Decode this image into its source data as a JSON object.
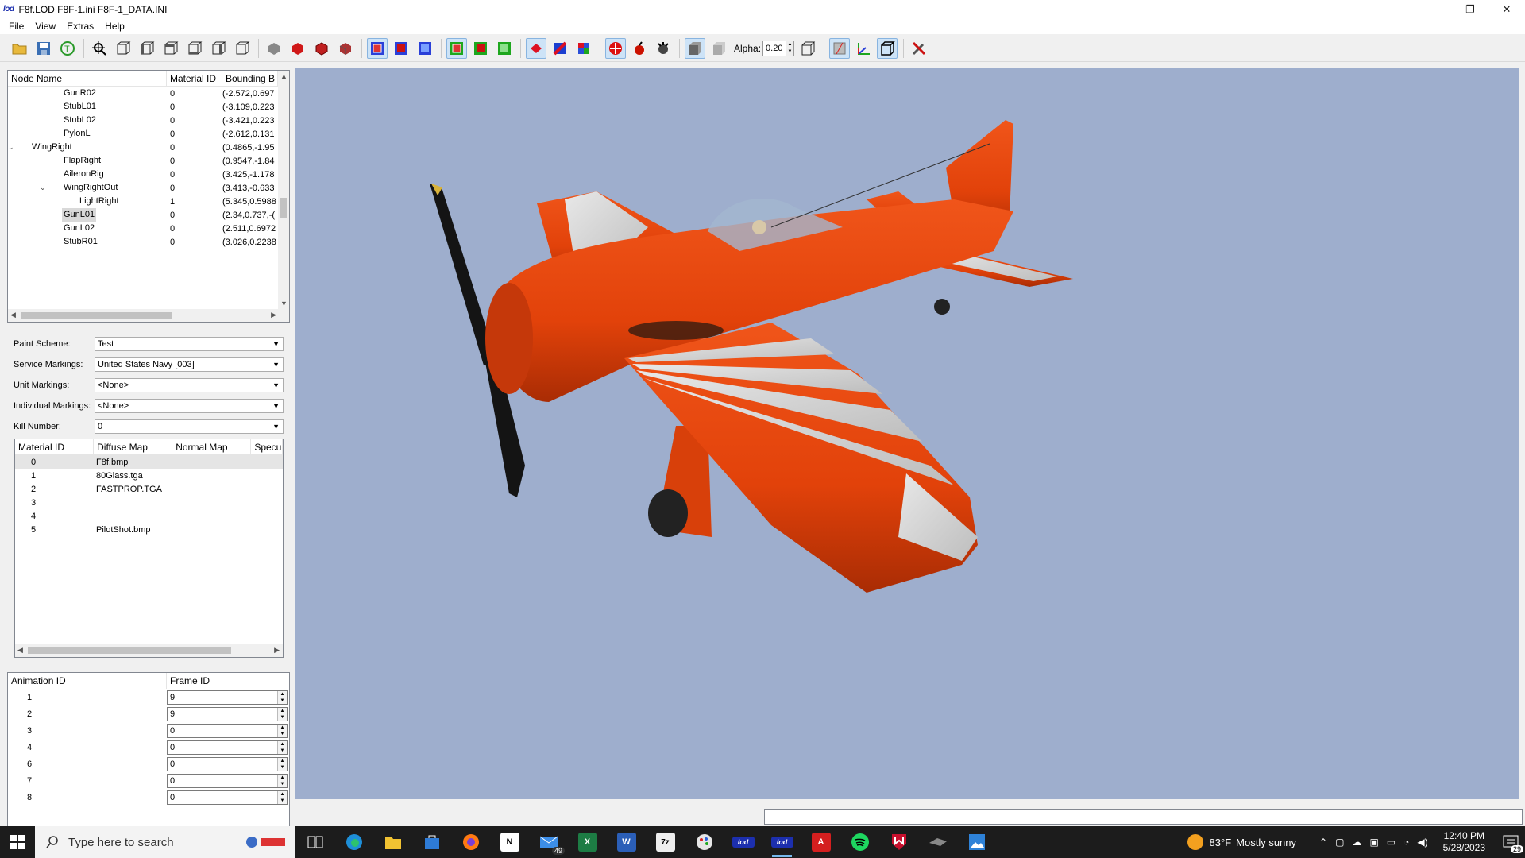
{
  "window": {
    "logo": "lod",
    "title": "F8f.LOD  F8F-1.ini  F8F-1_DATA.INI",
    "controls": {
      "minimize": "—",
      "restore": "❐",
      "close": "✕"
    }
  },
  "menu": [
    "File",
    "View",
    "Extras",
    "Help"
  ],
  "toolbar": {
    "alpha_label": "Alpha:",
    "alpha_value": "0.20"
  },
  "node_tree": {
    "headers": [
      "Node Name",
      "Material ID",
      "Bounding B"
    ],
    "rows": [
      {
        "name": "GunR02",
        "material": "0",
        "bounds": "(-2.572,0.697",
        "indent": 2,
        "caret": ""
      },
      {
        "name": "StubL01",
        "material": "0",
        "bounds": "(-3.109,0.223",
        "indent": 2,
        "caret": ""
      },
      {
        "name": "StubL02",
        "material": "0",
        "bounds": "(-3.421,0.223",
        "indent": 2,
        "caret": ""
      },
      {
        "name": "PylonL",
        "material": "0",
        "bounds": "(-2.612,0.131",
        "indent": 2,
        "caret": ""
      },
      {
        "name": "WingRight",
        "material": "0",
        "bounds": "(0.4865,-1.95",
        "indent": 1,
        "caret": "v"
      },
      {
        "name": "FlapRight",
        "material": "0",
        "bounds": "(0.9547,-1.84",
        "indent": 2,
        "caret": ""
      },
      {
        "name": "AileronRig",
        "material": "0",
        "bounds": "(3.425,-1.178",
        "indent": 2,
        "caret": ""
      },
      {
        "name": "WingRightOut",
        "material": "0",
        "bounds": "(3.413,-0.633",
        "indent": 2,
        "caret": "v"
      },
      {
        "name": "LightRight",
        "material": "1",
        "bounds": "(5.345,0.5988",
        "indent": 3,
        "caret": ""
      },
      {
        "name": "GunL01",
        "material": "0",
        "bounds": "(2.34,0.737,-(",
        "indent": 2,
        "caret": "",
        "selected": true
      },
      {
        "name": "GunL02",
        "material": "0",
        "bounds": "(2.511,0.6972",
        "indent": 2,
        "caret": ""
      },
      {
        "name": "StubR01",
        "material": "0",
        "bounds": "(3.026,0.2238",
        "indent": 2,
        "caret": ""
      }
    ]
  },
  "properties": {
    "paint_scheme": {
      "label": "Paint Scheme:",
      "value": "Test"
    },
    "service_markings": {
      "label": "Service Markings:",
      "value": "United States Navy [003]"
    },
    "unit_markings": {
      "label": "Unit Markings:",
      "value": "<None>"
    },
    "individual_markings": {
      "label": "Individual Markings:",
      "value": "<None>"
    },
    "kill_number": {
      "label": "Kill Number:",
      "value": "0"
    }
  },
  "materials": {
    "headers": [
      "Material ID",
      "Diffuse Map",
      "Normal Map",
      "Specu"
    ],
    "rows": [
      {
        "id": "0",
        "diffuse": "F8f.bmp"
      },
      {
        "id": "1",
        "diffuse": "80Glass.tga"
      },
      {
        "id": "2",
        "diffuse": "FASTPROP.TGA"
      },
      {
        "id": "3",
        "diffuse": ""
      },
      {
        "id": "4",
        "diffuse": ""
      },
      {
        "id": "5",
        "diffuse": "PilotShot.bmp"
      }
    ]
  },
  "animations": {
    "headers": [
      "Animation ID",
      "Frame ID"
    ],
    "rows": [
      {
        "id": "1",
        "frame": "9"
      },
      {
        "id": "2",
        "frame": "9"
      },
      {
        "id": "3",
        "frame": "0"
      },
      {
        "id": "4",
        "frame": "0"
      },
      {
        "id": "6",
        "frame": "0"
      },
      {
        "id": "7",
        "frame": "0"
      },
      {
        "id": "8",
        "frame": "0"
      }
    ]
  },
  "taskbar": {
    "search_placeholder": "Type here to search",
    "mail_badge": "49",
    "weather_temp": "83°F",
    "weather_text": "Mostly sunny",
    "time": "12:40 PM",
    "date": "5/28/2023",
    "notifications": "29"
  },
  "colors": {
    "viewport_bg": "#9eaecd",
    "plane_orange": "#e2420a",
    "accent": "#1c2fae"
  }
}
